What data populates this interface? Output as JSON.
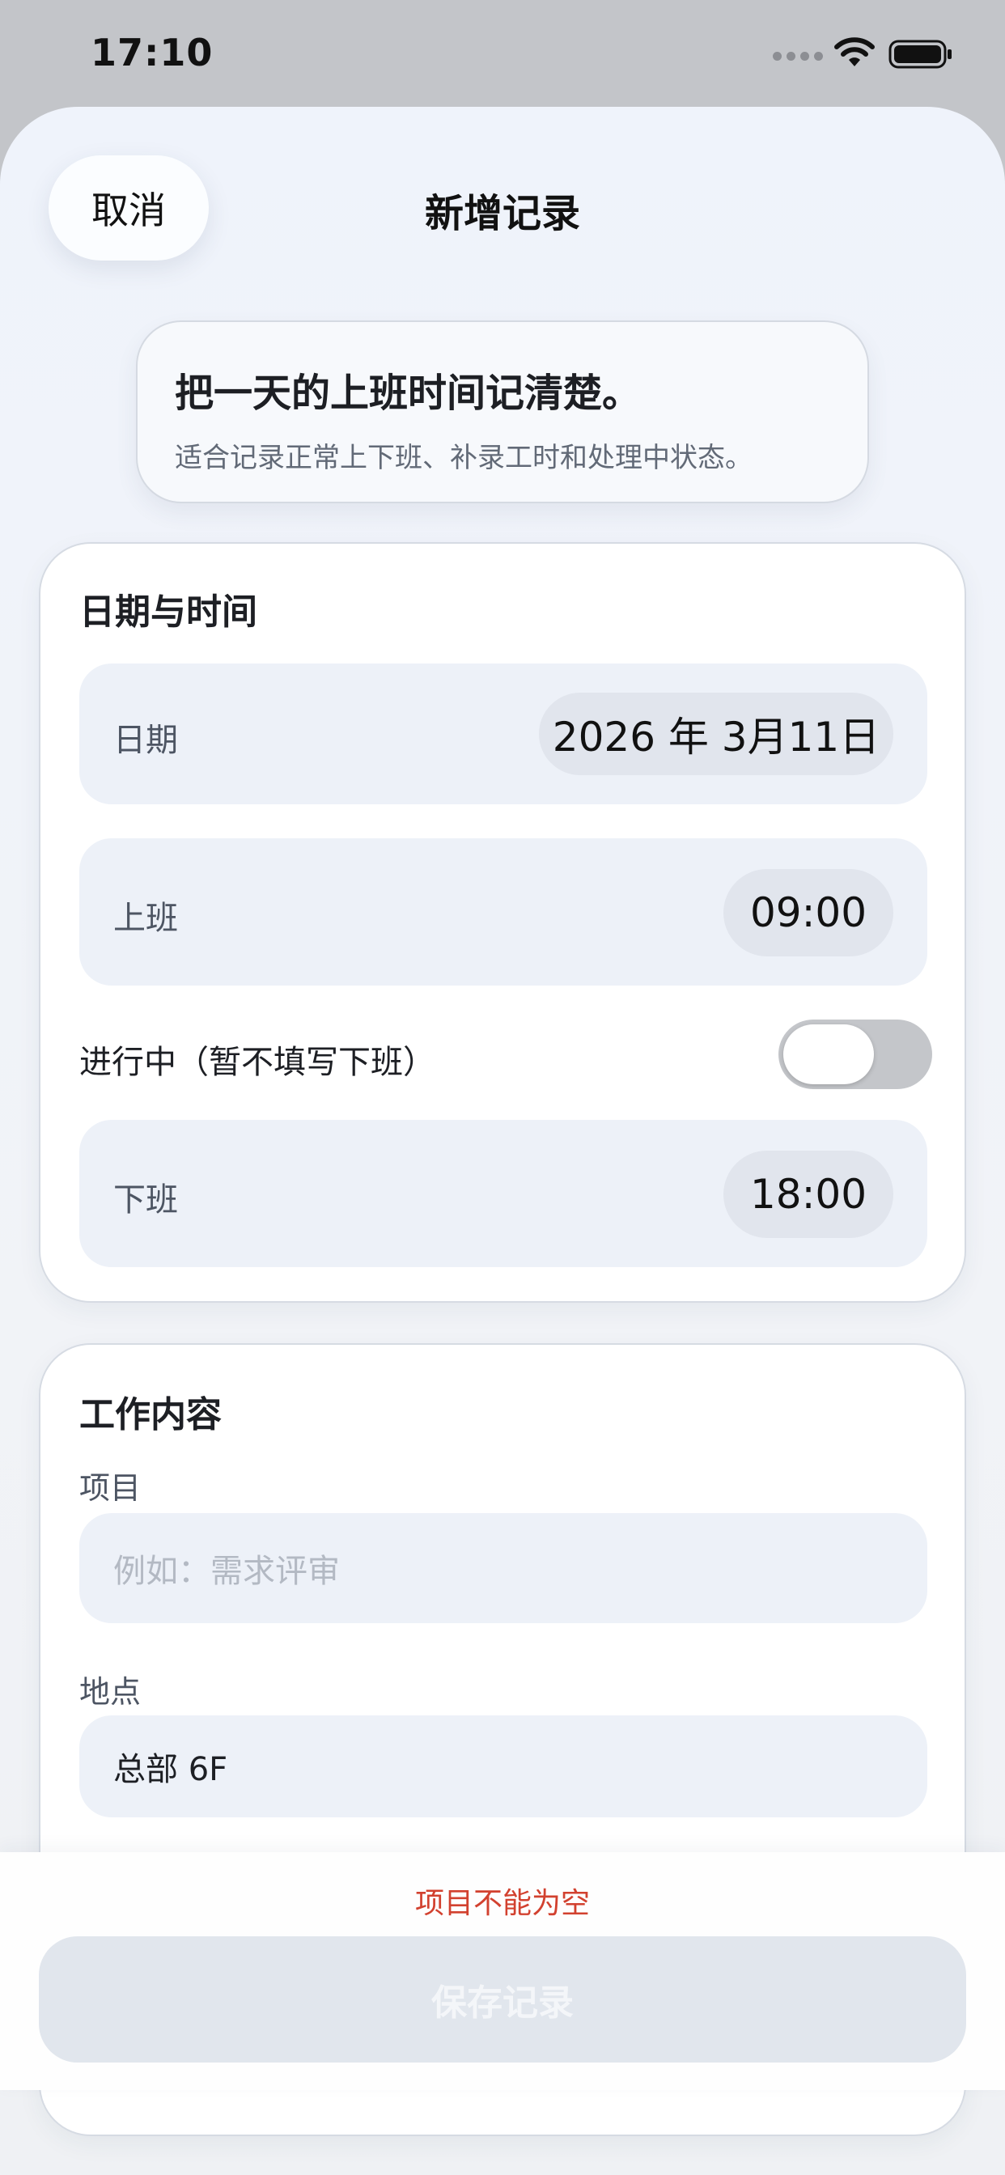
{
  "status": {
    "time": "17:10"
  },
  "nav": {
    "cancel": "取消",
    "title": "新增记录"
  },
  "intro": {
    "title": "把一天的上班时间记清楚。",
    "subtitle": "适合记录正常上下班、补录工时和处理中状态。"
  },
  "datetime_card": {
    "title": "日期与时间",
    "date_label": "日期",
    "date_value": "2026 年 3月11日",
    "start_label": "上班",
    "start_value": "09:00",
    "ongoing_label": "进行中（暂不填写下班）",
    "ongoing_on": false,
    "end_label": "下班",
    "end_value": "18:00"
  },
  "work_card": {
    "title": "工作内容",
    "project_label": "项目",
    "project_placeholder": "例如：需求评审",
    "location_label": "地点",
    "location_value": "总部 6F"
  },
  "footer": {
    "error": "项目不能为空",
    "save": "保存记录"
  },
  "colors": {
    "error": "#d2412f",
    "toggle_off": "#c4c6ca",
    "save_disabled": "#e1e6ed"
  }
}
